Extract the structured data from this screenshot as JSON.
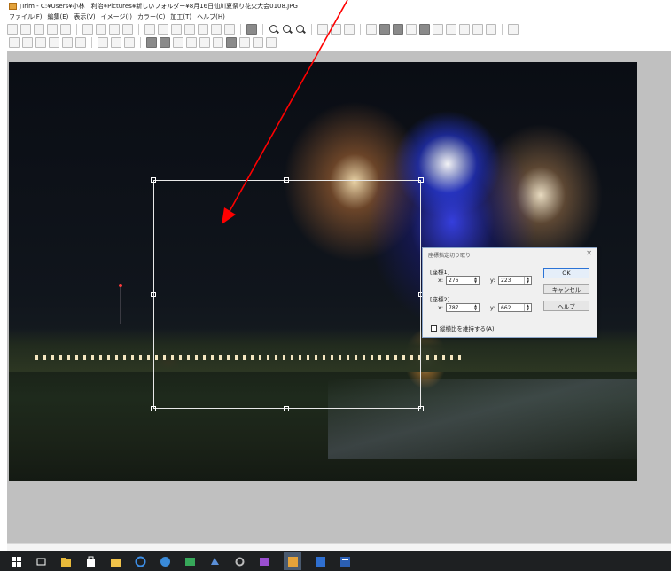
{
  "window": {
    "title": "JTrim - C:¥Users¥小林　利治¥Pictures¥新しいフォルダー¥8月16日仙川夏祭り花火大会0108.JPG"
  },
  "menu": [
    "ファイル(F)",
    "編集(E)",
    "表示(V)",
    "イメージ(I)",
    "カラー(C)",
    "加工(T)",
    "ヘルプ(H)"
  ],
  "toolbar": {
    "row1_icons": [
      "new-icon",
      "open-icon",
      "save-icon",
      "print-icon",
      "preview-icon",
      "copy-icon",
      "paste-icon",
      "paste-new-icon",
      "send-icon",
      "undo-icon",
      "redo-icon",
      "fit-window-icon",
      "text-icon",
      "stamp-icon",
      "grid-icon",
      "frame-icon",
      "color-box-icon",
      "zoom-in-icon",
      "zoom-out-icon",
      "zoom-actual-icon",
      "crop-icon",
      "rotate-icon",
      "flip-icon",
      "brightness-icon",
      "contrast-icon",
      "color-balance-icon",
      "grayscale-icon",
      "sepia-icon",
      "gamma-icon",
      "negative-icon",
      "mosaic-icon",
      "soften-icon",
      "sharpen-icon",
      "pen-icon"
    ],
    "row2_icons": [
      "rect-select-icon",
      "cut-select-icon",
      "flip-h-icon",
      "flip-v-icon",
      "move-icon",
      "image-icon",
      "rotate-left-icon",
      "rotate-right-icon",
      "resize-icon",
      "border-icon",
      "blur-icon",
      "noise-icon",
      "dither-icon",
      "emboss-icon",
      "wave-icon",
      "stretch-icon",
      "draw-line-icon",
      "fill-icon",
      "circle-icon"
    ]
  },
  "dialog": {
    "title": "座標指定切り取り",
    "close": "✕",
    "coord1_label": "[座標1]",
    "coord2_label": "[座標2]",
    "x_label": "x:",
    "y_label": "y:",
    "x1": "276",
    "y1": "223",
    "x2": "787",
    "y2": "662",
    "ok": "OK",
    "cancel": "キャンセル",
    "help": "ヘルプ",
    "keep_ratio": "縦横比を維持する(A)"
  },
  "taskbar": {
    "icons": [
      "windows-start-icon",
      "task-view-icon",
      "file-explorer-icon",
      "store-icon",
      "folder-icon",
      "edge-icon",
      "mail-icon",
      "photos-icon",
      "weather-icon",
      "settings-icon",
      "gallery-icon",
      "jtrim-icon",
      "media-icon",
      "word-icon"
    ],
    "active": "jtrim-icon"
  },
  "annotation": {
    "color": "#ff0000"
  },
  "colors": {
    "workspace": "#c0c0c0",
    "taskbar": "#1e2022",
    "dialog_border": "#8ba5c9"
  }
}
